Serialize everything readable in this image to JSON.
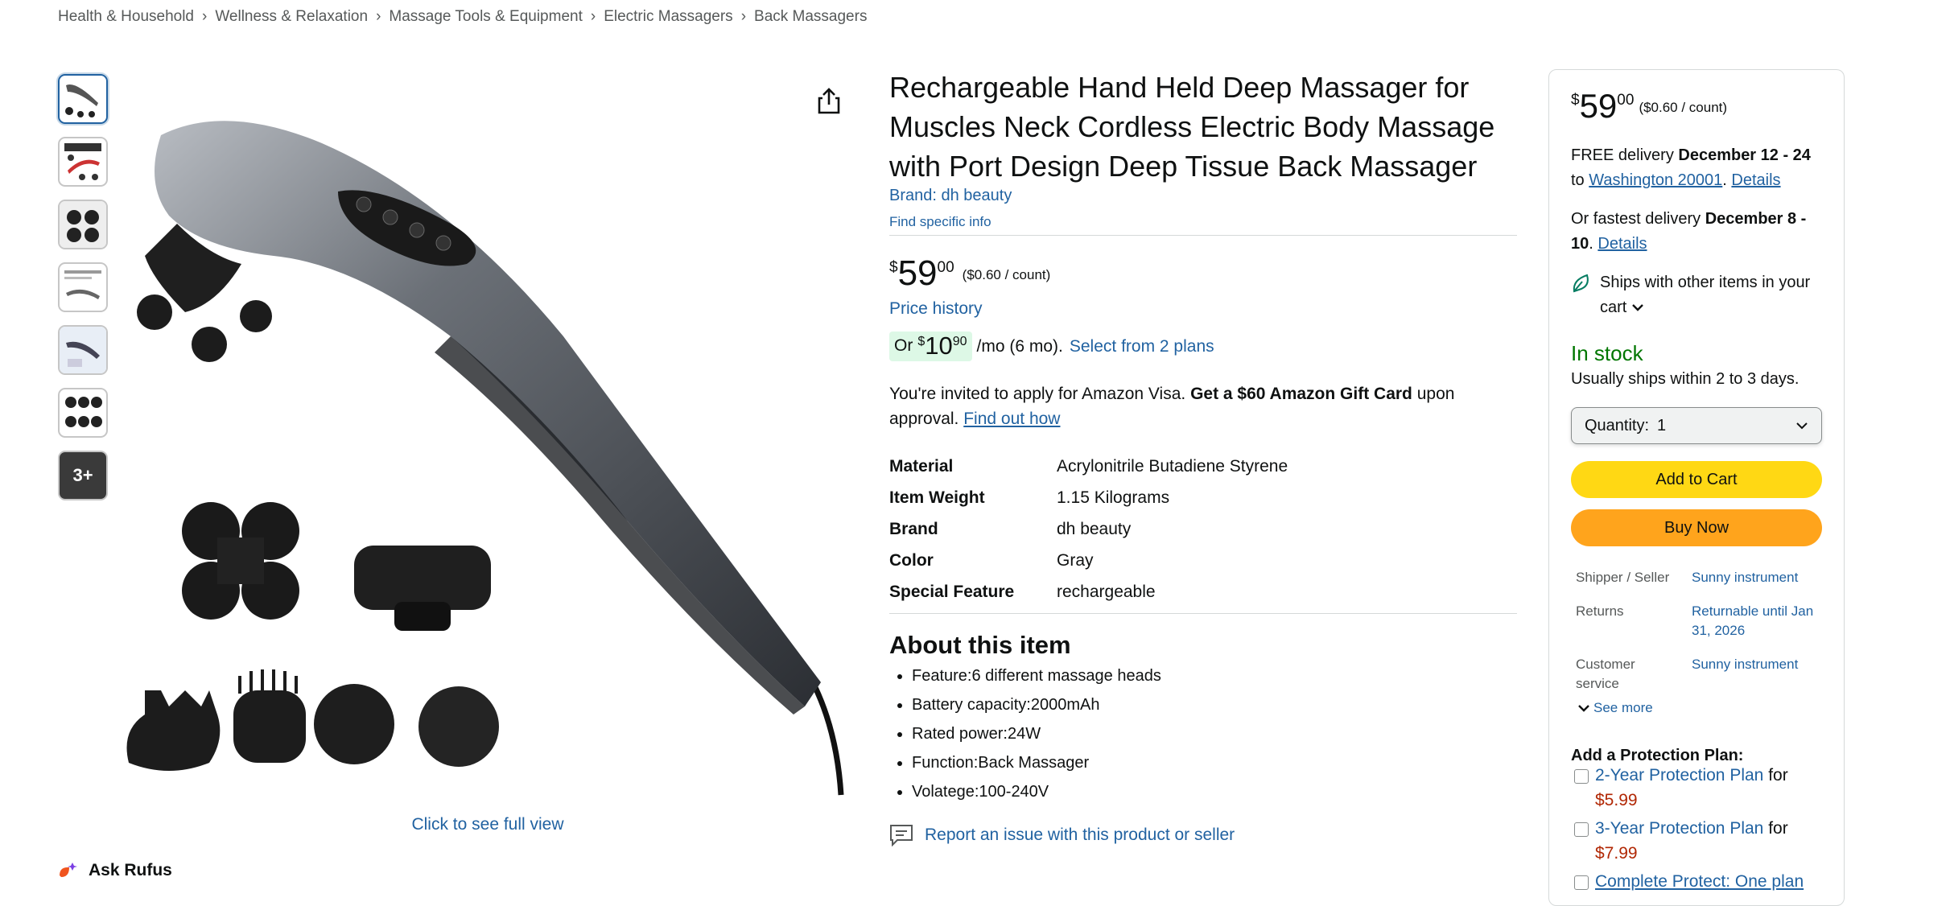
{
  "breadcrumb": [
    "Health & Household",
    "Wellness & Relaxation",
    "Massage Tools & Equipment",
    "Electric Massagers",
    "Back Massagers"
  ],
  "breadcrumb_sep": "›",
  "thumbnails": {
    "more_label": "3+"
  },
  "image": {
    "full_view_label": "Click to see full view"
  },
  "rufus": {
    "label": "Ask Rufus"
  },
  "product": {
    "title": "Rechargeable Hand Held Deep Massager for Muscles Neck Cordless Electric Body Massage with Port Design Deep Tissue Back Massager",
    "brand_link": "Brand: dh beauty",
    "find_info": "Find specific info",
    "price": {
      "symbol": "$",
      "whole": "59",
      "fraction": "00",
      "per_unit": "($0.60 / count)"
    },
    "price_history": "Price history",
    "monthly": {
      "or": "Or",
      "symbol": "$",
      "whole": "10",
      "fraction": "90",
      "term": "/mo (6 mo).",
      "plans_link": "Select from 2 plans"
    },
    "visa": {
      "text1": "You're invited to apply for Amazon Visa. ",
      "bold": "Get a $60 Amazon Gift Card",
      "text2": " upon approval. ",
      "link": "Find out how"
    },
    "specs": [
      {
        "label": "Material",
        "value": "Acrylonitrile Butadiene Styrene"
      },
      {
        "label": "Item Weight",
        "value": "1.15 Kilograms"
      },
      {
        "label": "Brand",
        "value": "dh beauty"
      },
      {
        "label": "Color",
        "value": "Gray"
      },
      {
        "label": "Special Feature",
        "value": "rechargeable"
      }
    ],
    "about_title": "About this item",
    "about": [
      "Feature:6 different massage heads",
      "Battery capacity:2000mAh",
      "Rated power:24W",
      "Function:Back Massager",
      "Volatege:100-240V"
    ],
    "report": "Report an issue with this product or seller"
  },
  "buybox": {
    "price": {
      "symbol": "$",
      "whole": "59",
      "fraction": "00",
      "per_unit": "($0.60 / count)"
    },
    "delivery": {
      "free": "FREE delivery ",
      "dates": "December 12 - 24",
      "to": "to ",
      "location": "Washington 20001",
      "dot": ". ",
      "details": "Details"
    },
    "fastest": {
      "text": "Or fastest delivery ",
      "dates": "December 8 - 10",
      "dot": ". ",
      "details": "Details"
    },
    "ships_with": "Ships with other items in your cart",
    "stock": "In stock",
    "usually": "Usually ships within 2 to 3 days.",
    "quantity_label": "Quantity:",
    "quantity_value": "1",
    "add_to_cart": "Add to Cart",
    "buy_now": "Buy Now",
    "info": [
      {
        "label": "Shipper / Seller",
        "value": "Sunny instrument"
      },
      {
        "label": "Returns",
        "value": "Returnable until Jan 31, 2026"
      },
      {
        "label": "Customer service",
        "value": "Sunny instrument"
      }
    ],
    "see_more": "See more",
    "protection_title": "Add a Protection Plan:",
    "plans": [
      {
        "name": "2-Year Protection Plan",
        "for": " for ",
        "price": "$5.99"
      },
      {
        "name": "3-Year Protection Plan",
        "for": " for ",
        "price": "$7.99"
      },
      {
        "name": "Complete Protect: One plan",
        "for": "",
        "price": ""
      }
    ]
  },
  "colors": {
    "link": "#2162A1",
    "in_stock": "#007600",
    "cart_button": "#FFD814",
    "buy_button": "#FFA41C",
    "plan_price": "#B12704",
    "monthly_highlight": "#DDF8E6"
  }
}
